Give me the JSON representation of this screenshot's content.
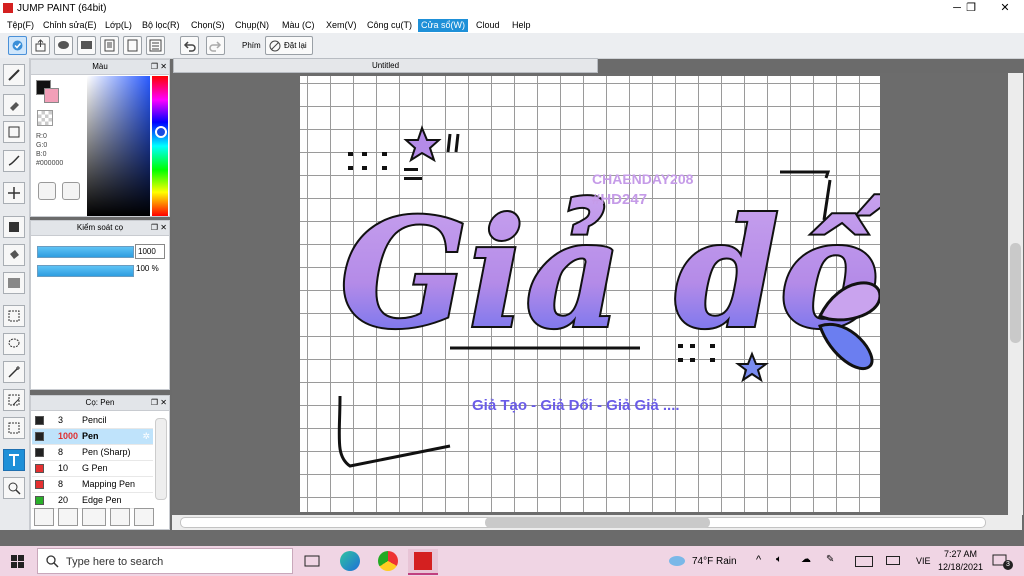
{
  "window": {
    "title": "JUMP PAINT (64bit)",
    "minimize": "─",
    "maximize": "❐",
    "close": "✕"
  },
  "menu": [
    "Tệp(F)",
    "Chỉnh sửa(E)",
    "Lớp(L)",
    "Bộ lọc(R)",
    "Chọn(S)",
    "Chụp(N)",
    "Màu (C)",
    "Xem(V)",
    "Công cụ(T)",
    "Cửa sổ(W)",
    "Cloud",
    "Help"
  ],
  "toolbar": {
    "phim_label": "Phím",
    "reset_label": "Đặt lại"
  },
  "color_panel": {
    "title": "Màu",
    "r": "R:0",
    "g": "G:0",
    "b": "B:0",
    "hex": "#000000"
  },
  "pen_control": {
    "title": "Kiểm soát cọ",
    "size_value": "1000",
    "opacity_value": "100 %"
  },
  "brush_panel": {
    "title": "Cọ: Pen",
    "brushes": [
      {
        "size": "3",
        "name": "Pencil",
        "color": "#222222"
      },
      {
        "size": "1000",
        "name": "Pen",
        "color": "#222222"
      },
      {
        "size": "8",
        "name": "Pen (Sharp)",
        "color": "#222222"
      },
      {
        "size": "10",
        "name": "G Pen",
        "color": "#e53030"
      },
      {
        "size": "8",
        "name": "Mapping Pen",
        "color": "#e53030"
      },
      {
        "size": "20",
        "name": "Edge Pen",
        "color": "#2ab02a"
      }
    ]
  },
  "canvas": {
    "tab_title": "Untitled",
    "artwork": {
      "main_text": "Giả dối",
      "watermark_line1": "CHAENDAY208",
      "watermark_line2": "#HD247",
      "subtitle": "Giả Tạo - Giả Dối - Giả Giả ...."
    }
  },
  "taskbar": {
    "search_placeholder": "Type here to search",
    "weather": "74°F  Rain",
    "language": "VIE",
    "time": "7:27 AM",
    "date": "12/18/2021",
    "notification_count": "3"
  },
  "colors": {
    "accent": "#1e90d8",
    "art_purple": "#b48be8",
    "art_blue": "#5b6cf0",
    "taskbar": "#f0d5e4"
  }
}
